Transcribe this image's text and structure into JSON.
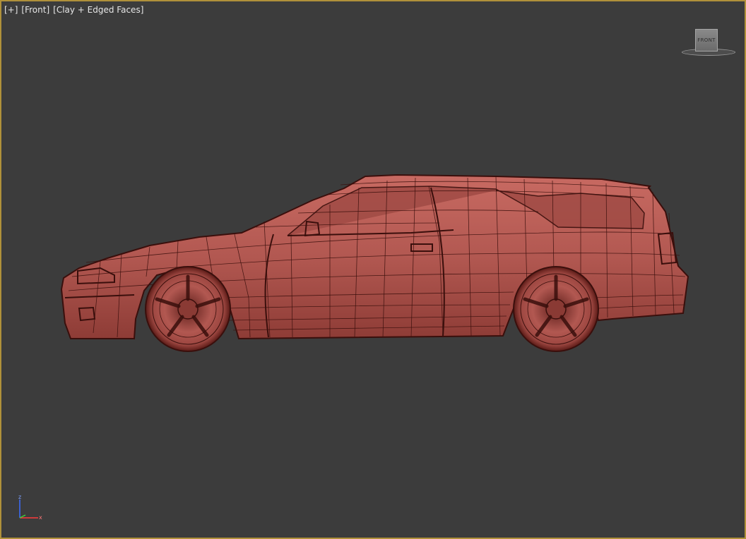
{
  "viewport": {
    "labels": {
      "plus": "[+]",
      "view": "[Front]",
      "shading": "[Clay + Edged Faces]"
    },
    "viewcube": {
      "face_label": "FRONT"
    },
    "axis": {
      "z_label": "z",
      "x_label": "x"
    },
    "colors": {
      "background": "#3c3c3c",
      "border": "#b0913a",
      "car_body": "#b25851",
      "car_wire": "#3a0f0c",
      "axis_z": "#3b6cff",
      "axis_x": "#ff3b3b",
      "axis_y": "#3bd23b"
    }
  }
}
